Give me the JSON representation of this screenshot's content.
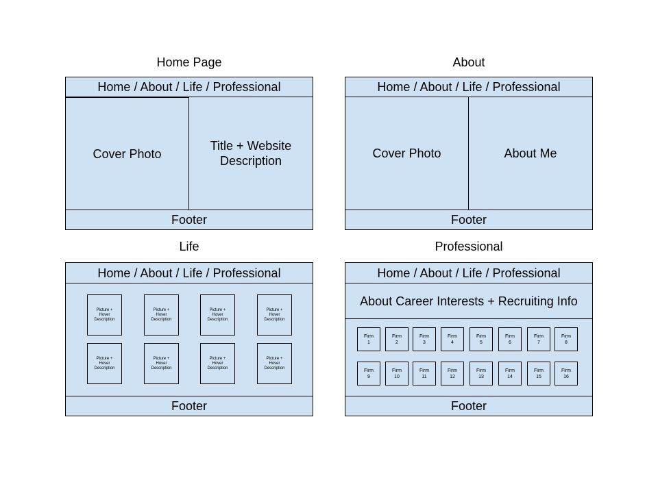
{
  "nav_text": "Home / About / Life / Professional",
  "footer_text": "Footer",
  "home": {
    "title": "Home Page",
    "left": "Cover Photo",
    "right": "Title + Website\nDescription"
  },
  "about": {
    "title": "About",
    "left": "Cover Photo",
    "right": "About Me"
  },
  "life": {
    "title": "Life",
    "tiles": [
      "Picture +\nHover\nDescription",
      "Picture +\nHover\nDescription",
      "Picture +\nHover\nDescription",
      "Picture +\nHover\nDescription",
      "Picture +\nHover\nDescription",
      "Picture +\nHover\nDescription",
      "Picture +\nHover\nDescription",
      "Picture +\nHover\nDescription"
    ]
  },
  "professional": {
    "title": "Professional",
    "header": "About Career Interests + Recruiting Info",
    "firms": [
      "Firm\n1",
      "Firm\n2",
      "Firm\n3",
      "Firm\n4",
      "Firm\n5",
      "Firm\n6",
      "Firm\n7",
      "Firm\n8",
      "Firm\n9",
      "Firm\n10",
      "Firm\n11",
      "Firm\n12",
      "Firm\n13",
      "Firm\n14",
      "Firm\n15",
      "Firm\n16"
    ]
  },
  "colors": {
    "box_fill": "#cfe2f3",
    "border": "#000000"
  }
}
